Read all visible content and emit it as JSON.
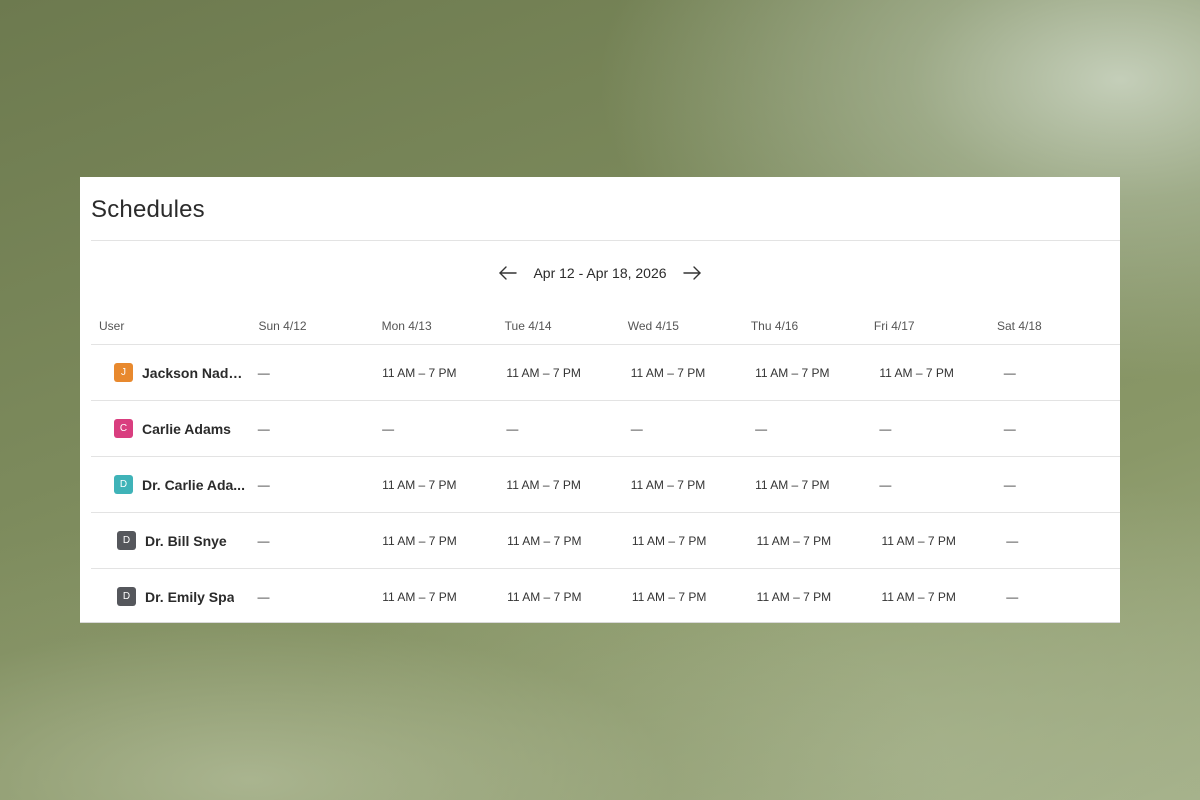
{
  "page": {
    "title": "Schedules"
  },
  "week_nav": {
    "label": "Apr 12 - Apr 18, 2026",
    "prev_icon": "arrow-left-icon",
    "next_icon": "arrow-right-icon"
  },
  "table": {
    "user_header": "User",
    "days": [
      "Sun 4/12",
      "Mon 4/13",
      "Tue 4/14",
      "Wed 4/15",
      "Thu 4/16",
      "Fri 4/17",
      "Sat 4/18"
    ],
    "rows": [
      {
        "initial": "J",
        "color": "#e8892e",
        "name": "Jackson Nada...",
        "cells": [
          "—",
          "11 AM – 7 PM",
          "11 AM – 7 PM",
          "11 AM – 7 PM",
          "11 AM – 7 PM",
          "11 AM – 7 PM",
          "—"
        ]
      },
      {
        "initial": "C",
        "color": "#d93e7f",
        "name": "Carlie Adams",
        "cells": [
          "—",
          "—",
          "—",
          "—",
          "—",
          "—",
          "—"
        ]
      },
      {
        "initial": "D",
        "color": "#3fb3b8",
        "name": "Dr. Carlie Ada...",
        "cells": [
          "—",
          "11 AM – 7 PM",
          "11 AM – 7 PM",
          "11 AM – 7 PM",
          "11 AM – 7 PM",
          "—",
          "—"
        ]
      },
      {
        "initial": "D",
        "color": "#55575c",
        "name": "Dr. Bill Snye",
        "cells": [
          "—",
          "11 AM – 7 PM",
          "11 AM – 7 PM",
          "11 AM – 7 PM",
          "11 AM – 7 PM",
          "11 AM – 7 PM",
          "—"
        ]
      },
      {
        "initial": "D",
        "color": "#55575c",
        "name": "Dr. Emily Spa",
        "cells": [
          "—",
          "11 AM – 7 PM",
          "11 AM – 7 PM",
          "11 AM – 7 PM",
          "11 AM – 7 PM",
          "11 AM – 7 PM",
          "—"
        ]
      }
    ]
  }
}
